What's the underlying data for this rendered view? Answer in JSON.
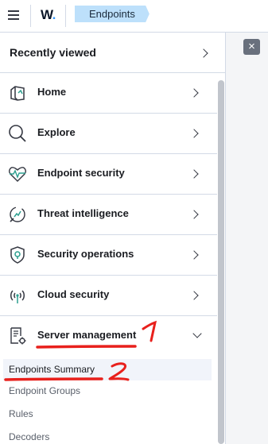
{
  "header": {
    "logo_text": "W",
    "logo_dot": ".",
    "breadcrumb": "Endpoints"
  },
  "close_label": "×",
  "nav": {
    "recently_viewed": "Recently viewed",
    "items": [
      {
        "label": "Home",
        "icon": "home-icon"
      },
      {
        "label": "Explore",
        "icon": "search-icon"
      },
      {
        "label": "Endpoint security",
        "icon": "heartbeat-shield-icon"
      },
      {
        "label": "Threat intelligence",
        "icon": "threat-radar-icon"
      },
      {
        "label": "Security operations",
        "icon": "shield-icon"
      },
      {
        "label": "Cloud security",
        "icon": "antenna-icon"
      },
      {
        "label": "Server management",
        "icon": "document-gear-icon",
        "expanded": true
      }
    ],
    "subitems": [
      {
        "label": "Endpoints Summary",
        "active": true
      },
      {
        "label": "Endpoint Groups"
      },
      {
        "label": "Rules"
      },
      {
        "label": "Decoders"
      }
    ]
  },
  "annotations": {
    "mark_1": "1",
    "mark_2": "2",
    "color": "#e8201c"
  }
}
